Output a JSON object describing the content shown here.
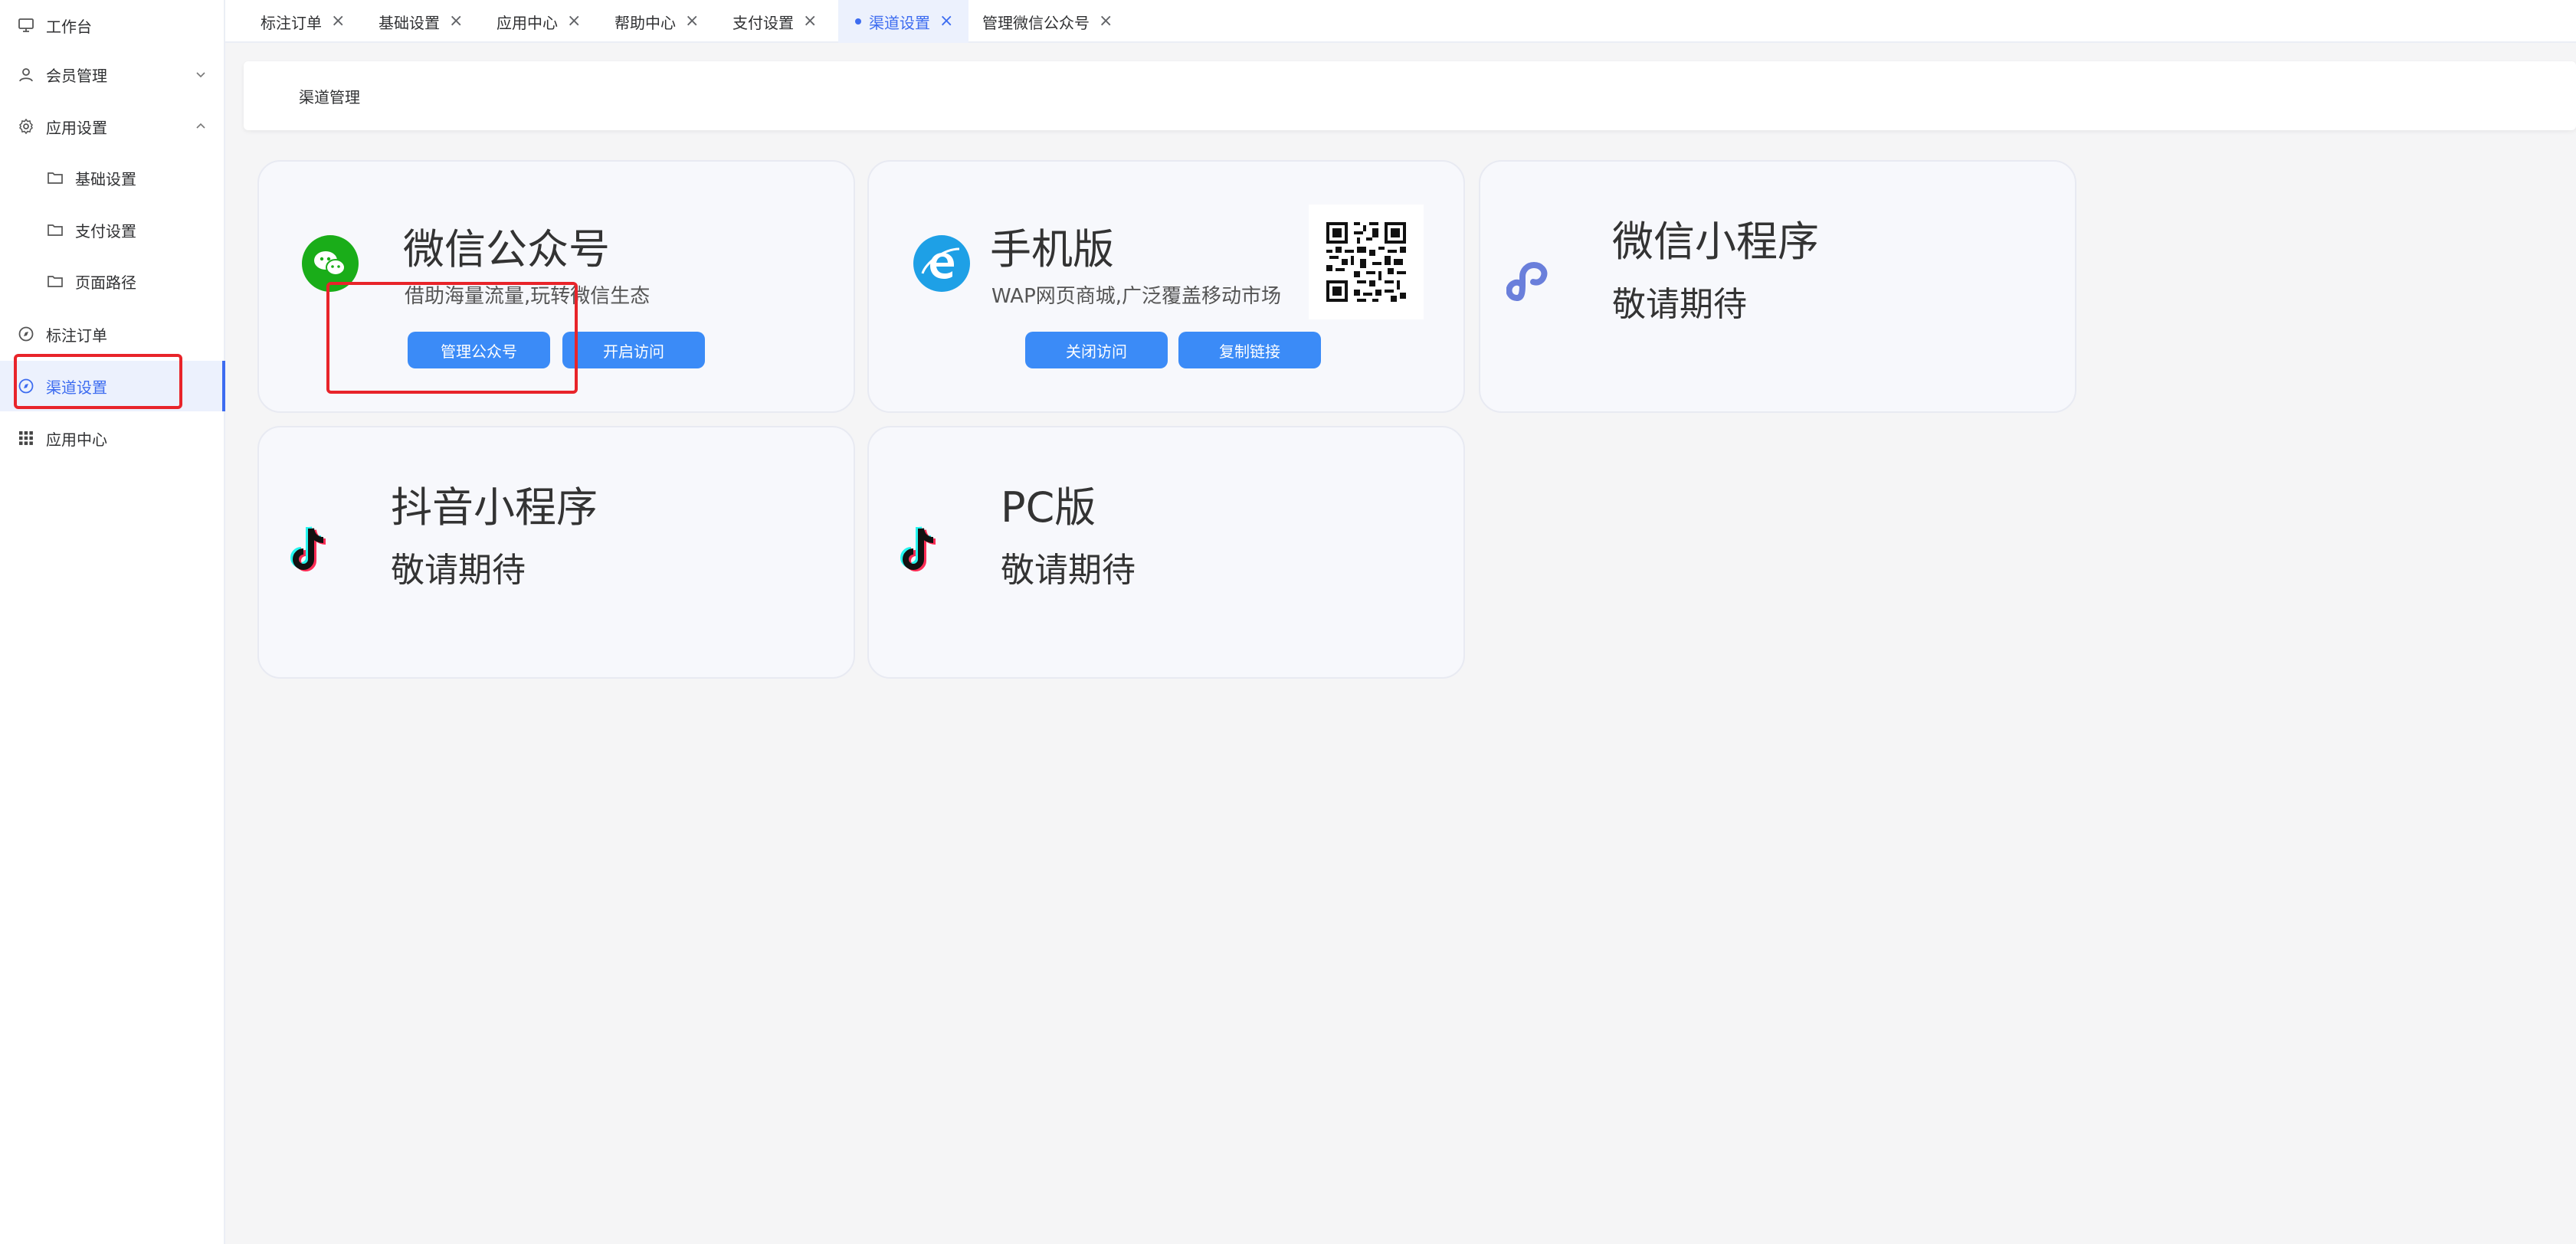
{
  "sidebar": {
    "items": [
      {
        "label": "工作台"
      },
      {
        "label": "会员管理"
      },
      {
        "label": "应用设置"
      },
      {
        "label": "基础设置"
      },
      {
        "label": "支付设置"
      },
      {
        "label": "页面路径"
      },
      {
        "label": "标注订单"
      },
      {
        "label": "渠道设置"
      },
      {
        "label": "应用中心"
      }
    ]
  },
  "tabs": [
    {
      "label": "标注订单",
      "close": "×"
    },
    {
      "label": "基础设置",
      "close": "×"
    },
    {
      "label": "应用中心",
      "close": "×"
    },
    {
      "label": "帮助中心",
      "close": "×"
    },
    {
      "label": "支付设置",
      "close": "×"
    },
    {
      "label": "渠道设置",
      "close": "×"
    },
    {
      "label": "管理微信公众号",
      "close": "×"
    }
  ],
  "page": {
    "title": "渠道管理"
  },
  "cards": {
    "wechat_official": {
      "title": "微信公众号",
      "desc": "借助海量流量,玩转微信生态",
      "btn_manage": "管理公众号",
      "btn_open": "开启访问",
      "icon": "wechat-icon"
    },
    "mobile": {
      "title": "手机版",
      "desc": "WAP网页商城,广泛覆盖移动市场",
      "btn_close": "关闭访问",
      "btn_copy": "复制链接",
      "icon": "ie-browser-icon"
    },
    "mini_program": {
      "title": "微信小程序",
      "soon": "敬请期待",
      "icon": "mini-program-icon"
    },
    "douyin": {
      "title": "抖音小程序",
      "soon": "敬请期待",
      "icon": "tiktok-icon"
    },
    "pc": {
      "title": "PC版",
      "soon": "敬请期待",
      "icon": "tiktok-icon"
    }
  },
  "colors": {
    "accent": "#3d6cf0",
    "button": "#3b8bf7",
    "highlight": "#e8242a",
    "wechat": "#1aad19",
    "ie": "#1ea0e6",
    "mini": "#6a7fdb"
  }
}
